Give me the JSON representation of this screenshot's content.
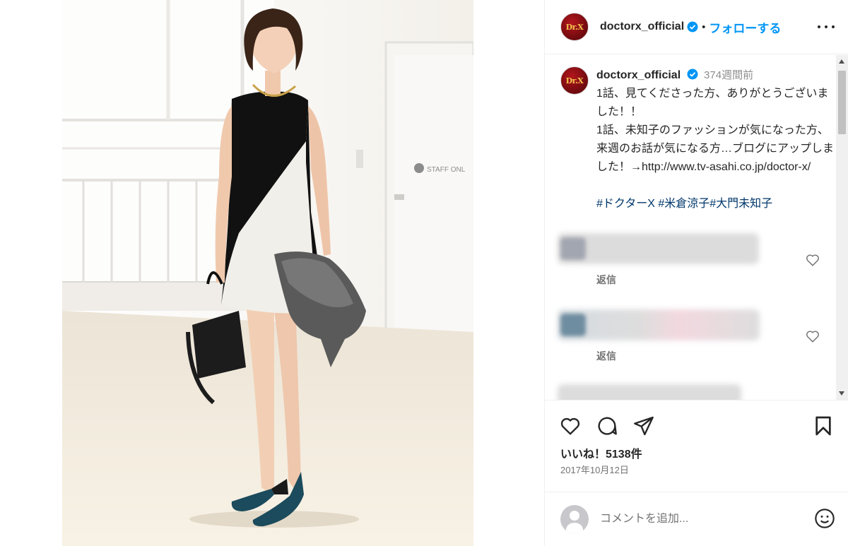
{
  "post": {
    "username": "doctorx_official",
    "avatar_label": "Dr.X",
    "separator": "•",
    "follow_label": "フォローする",
    "more_icon": "more-horizontal-icon"
  },
  "caption": {
    "username": "doctorx_official",
    "time": "374週間前",
    "text": "1話、見てくださった方、ありがとうございました！！\n1話、未知子のファッションが気になった方、来週のお話が気になる方…ブログにアップしました！→http://www.tv-asahi.co.jp/doctor-x/",
    "hashtags": "#ドクターX #米倉涼子#大門未知子"
  },
  "comments": [
    {
      "reply_label": "返信",
      "icon": "heart-outline-icon"
    },
    {
      "reply_label": "返信",
      "icon": "heart-outline-icon"
    },
    {
      "reply_label": "",
      "icon": ""
    }
  ],
  "actions": {
    "like_icon": "heart-outline-icon",
    "comment_icon": "comment-bubble-icon",
    "share_icon": "paper-plane-icon",
    "save_icon": "bookmark-icon",
    "likes_text": "いいね！5138件",
    "date_text": "2017年10月12日"
  },
  "comment_box": {
    "placeholder": "コメントを追加...",
    "emoji_icon": "smiley-icon"
  },
  "colors": {
    "accent": "#0095f6",
    "hashtag": "#00376b",
    "muted": "#737373",
    "border": "#efefef"
  }
}
